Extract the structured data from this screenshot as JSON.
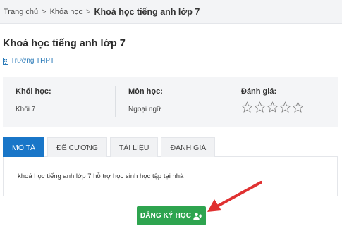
{
  "breadcrumb": {
    "home": "Trang chủ",
    "courses": "Khóa học",
    "current": "Khoá học tiếng anh lớp 7",
    "separator": ">"
  },
  "course": {
    "title": "Khoá học tiếng anh lớp 7",
    "school": "Trường THPT"
  },
  "info": {
    "grade_label": "Khối học:",
    "grade_value": "Khối 7",
    "subject_label": "Môn học:",
    "subject_value": "Ngoại ngữ",
    "rating_label": "Đánh giá:",
    "rating_value": 0,
    "rating_max": 5
  },
  "tabs": [
    {
      "label": "MÔ TẢ",
      "active": true
    },
    {
      "label": "ĐỀ CƯƠNG",
      "active": false
    },
    {
      "label": "TÀI LIỆU",
      "active": false
    },
    {
      "label": "ĐÁNH GIÁ",
      "active": false
    }
  ],
  "description": "khoá học tiếng anh lớp 7 hỗ trợ học sinh học tập tại nhà",
  "register_button": "ĐĂNG KÝ HỌC",
  "colors": {
    "accent_blue": "#1976c8",
    "button_green": "#2ea44f",
    "annotation_red": "#e03131",
    "link_blue": "#2a7ab8"
  },
  "icons": {
    "school": "building-icon",
    "register": "user-plus-icon",
    "rating": "star-outline-icon",
    "annotation": "arrow-pointer-icon"
  }
}
